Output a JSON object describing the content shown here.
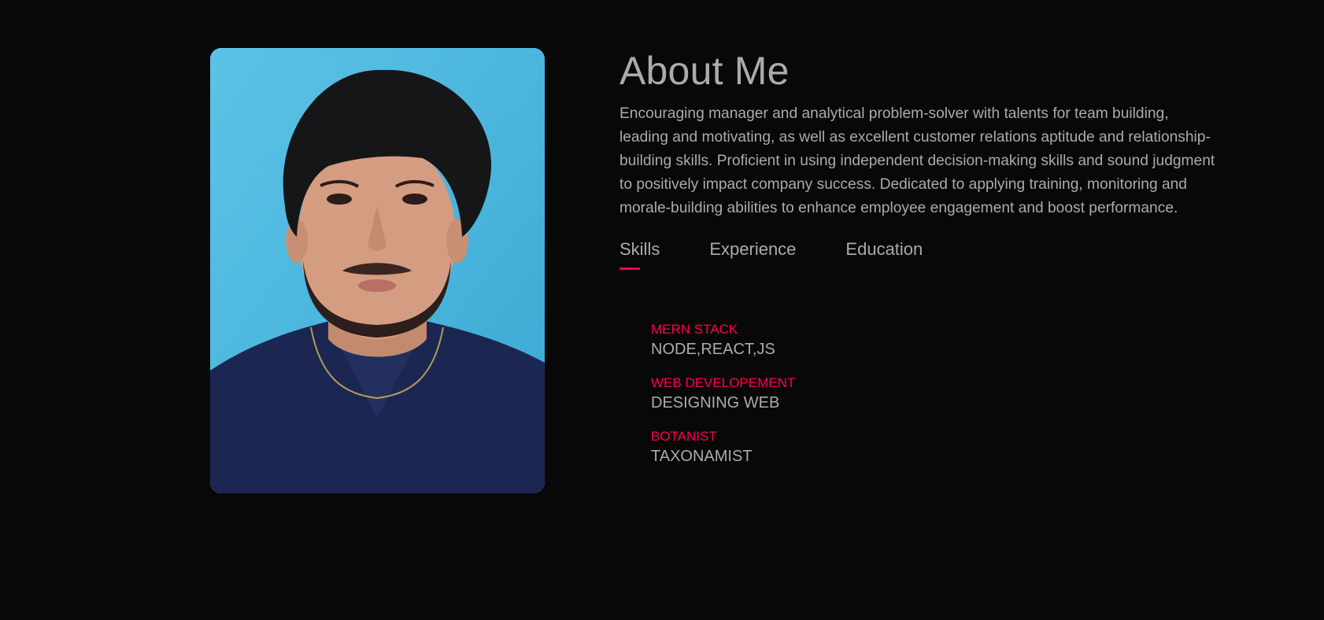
{
  "about": {
    "title": "About Me",
    "bio": "Encouraging manager and analytical problem-solver with talents for team building, leading and motivating, as well as excellent customer relations aptitude and relationship-building skills. Proficient in using independent decision-making skills and sound judgment to positively impact company success. Dedicated to applying training, monitoring and morale-building abilities to enhance employee engagement and boost performance."
  },
  "photo": {
    "alt": "profile-photo"
  },
  "tabs": [
    {
      "label": "Skills",
      "active": true
    },
    {
      "label": "Experience",
      "active": false
    },
    {
      "label": "Education",
      "active": false
    }
  ],
  "skills": [
    {
      "category": "MERN STACK",
      "value": "NODE,REACT,JS"
    },
    {
      "category": "WEB DEVELOPEMENT",
      "value": "DESIGNING WEB"
    },
    {
      "category": "BOTANIST",
      "value": "TAXONAMIST"
    }
  ],
  "colors": {
    "background": "#080808",
    "text": "#ababab",
    "accent": "#ff004f",
    "photo_bg": "#4fb8de"
  }
}
